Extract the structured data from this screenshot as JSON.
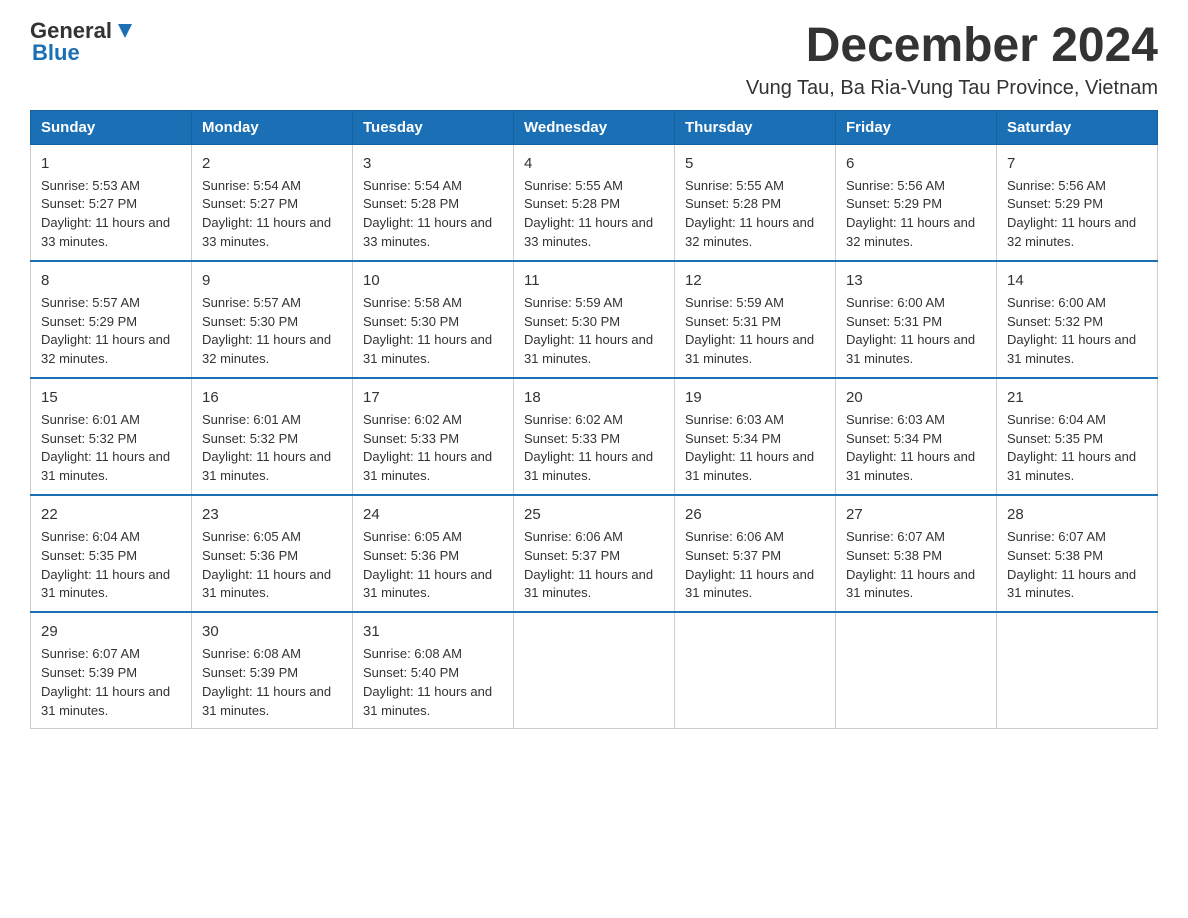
{
  "header": {
    "logo": {
      "general": "General",
      "blue": "Blue"
    },
    "month_title": "December 2024",
    "location": "Vung Tau, Ba Ria-Vung Tau Province, Vietnam"
  },
  "days_of_week": [
    "Sunday",
    "Monday",
    "Tuesday",
    "Wednesday",
    "Thursday",
    "Friday",
    "Saturday"
  ],
  "weeks": [
    [
      {
        "day": "1",
        "sunrise": "Sunrise: 5:53 AM",
        "sunset": "Sunset: 5:27 PM",
        "daylight": "Daylight: 11 hours and 33 minutes."
      },
      {
        "day": "2",
        "sunrise": "Sunrise: 5:54 AM",
        "sunset": "Sunset: 5:27 PM",
        "daylight": "Daylight: 11 hours and 33 minutes."
      },
      {
        "day": "3",
        "sunrise": "Sunrise: 5:54 AM",
        "sunset": "Sunset: 5:28 PM",
        "daylight": "Daylight: 11 hours and 33 minutes."
      },
      {
        "day": "4",
        "sunrise": "Sunrise: 5:55 AM",
        "sunset": "Sunset: 5:28 PM",
        "daylight": "Daylight: 11 hours and 33 minutes."
      },
      {
        "day": "5",
        "sunrise": "Sunrise: 5:55 AM",
        "sunset": "Sunset: 5:28 PM",
        "daylight": "Daylight: 11 hours and 32 minutes."
      },
      {
        "day": "6",
        "sunrise": "Sunrise: 5:56 AM",
        "sunset": "Sunset: 5:29 PM",
        "daylight": "Daylight: 11 hours and 32 minutes."
      },
      {
        "day": "7",
        "sunrise": "Sunrise: 5:56 AM",
        "sunset": "Sunset: 5:29 PM",
        "daylight": "Daylight: 11 hours and 32 minutes."
      }
    ],
    [
      {
        "day": "8",
        "sunrise": "Sunrise: 5:57 AM",
        "sunset": "Sunset: 5:29 PM",
        "daylight": "Daylight: 11 hours and 32 minutes."
      },
      {
        "day": "9",
        "sunrise": "Sunrise: 5:57 AM",
        "sunset": "Sunset: 5:30 PM",
        "daylight": "Daylight: 11 hours and 32 minutes."
      },
      {
        "day": "10",
        "sunrise": "Sunrise: 5:58 AM",
        "sunset": "Sunset: 5:30 PM",
        "daylight": "Daylight: 11 hours and 31 minutes."
      },
      {
        "day": "11",
        "sunrise": "Sunrise: 5:59 AM",
        "sunset": "Sunset: 5:30 PM",
        "daylight": "Daylight: 11 hours and 31 minutes."
      },
      {
        "day": "12",
        "sunrise": "Sunrise: 5:59 AM",
        "sunset": "Sunset: 5:31 PM",
        "daylight": "Daylight: 11 hours and 31 minutes."
      },
      {
        "day": "13",
        "sunrise": "Sunrise: 6:00 AM",
        "sunset": "Sunset: 5:31 PM",
        "daylight": "Daylight: 11 hours and 31 minutes."
      },
      {
        "day": "14",
        "sunrise": "Sunrise: 6:00 AM",
        "sunset": "Sunset: 5:32 PM",
        "daylight": "Daylight: 11 hours and 31 minutes."
      }
    ],
    [
      {
        "day": "15",
        "sunrise": "Sunrise: 6:01 AM",
        "sunset": "Sunset: 5:32 PM",
        "daylight": "Daylight: 11 hours and 31 minutes."
      },
      {
        "day": "16",
        "sunrise": "Sunrise: 6:01 AM",
        "sunset": "Sunset: 5:32 PM",
        "daylight": "Daylight: 11 hours and 31 minutes."
      },
      {
        "day": "17",
        "sunrise": "Sunrise: 6:02 AM",
        "sunset": "Sunset: 5:33 PM",
        "daylight": "Daylight: 11 hours and 31 minutes."
      },
      {
        "day": "18",
        "sunrise": "Sunrise: 6:02 AM",
        "sunset": "Sunset: 5:33 PM",
        "daylight": "Daylight: 11 hours and 31 minutes."
      },
      {
        "day": "19",
        "sunrise": "Sunrise: 6:03 AM",
        "sunset": "Sunset: 5:34 PM",
        "daylight": "Daylight: 11 hours and 31 minutes."
      },
      {
        "day": "20",
        "sunrise": "Sunrise: 6:03 AM",
        "sunset": "Sunset: 5:34 PM",
        "daylight": "Daylight: 11 hours and 31 minutes."
      },
      {
        "day": "21",
        "sunrise": "Sunrise: 6:04 AM",
        "sunset": "Sunset: 5:35 PM",
        "daylight": "Daylight: 11 hours and 31 minutes."
      }
    ],
    [
      {
        "day": "22",
        "sunrise": "Sunrise: 6:04 AM",
        "sunset": "Sunset: 5:35 PM",
        "daylight": "Daylight: 11 hours and 31 minutes."
      },
      {
        "day": "23",
        "sunrise": "Sunrise: 6:05 AM",
        "sunset": "Sunset: 5:36 PM",
        "daylight": "Daylight: 11 hours and 31 minutes."
      },
      {
        "day": "24",
        "sunrise": "Sunrise: 6:05 AM",
        "sunset": "Sunset: 5:36 PM",
        "daylight": "Daylight: 11 hours and 31 minutes."
      },
      {
        "day": "25",
        "sunrise": "Sunrise: 6:06 AM",
        "sunset": "Sunset: 5:37 PM",
        "daylight": "Daylight: 11 hours and 31 minutes."
      },
      {
        "day": "26",
        "sunrise": "Sunrise: 6:06 AM",
        "sunset": "Sunset: 5:37 PM",
        "daylight": "Daylight: 11 hours and 31 minutes."
      },
      {
        "day": "27",
        "sunrise": "Sunrise: 6:07 AM",
        "sunset": "Sunset: 5:38 PM",
        "daylight": "Daylight: 11 hours and 31 minutes."
      },
      {
        "day": "28",
        "sunrise": "Sunrise: 6:07 AM",
        "sunset": "Sunset: 5:38 PM",
        "daylight": "Daylight: 11 hours and 31 minutes."
      }
    ],
    [
      {
        "day": "29",
        "sunrise": "Sunrise: 6:07 AM",
        "sunset": "Sunset: 5:39 PM",
        "daylight": "Daylight: 11 hours and 31 minutes."
      },
      {
        "day": "30",
        "sunrise": "Sunrise: 6:08 AM",
        "sunset": "Sunset: 5:39 PM",
        "daylight": "Daylight: 11 hours and 31 minutes."
      },
      {
        "day": "31",
        "sunrise": "Sunrise: 6:08 AM",
        "sunset": "Sunset: 5:40 PM",
        "daylight": "Daylight: 11 hours and 31 minutes."
      },
      null,
      null,
      null,
      null
    ]
  ]
}
